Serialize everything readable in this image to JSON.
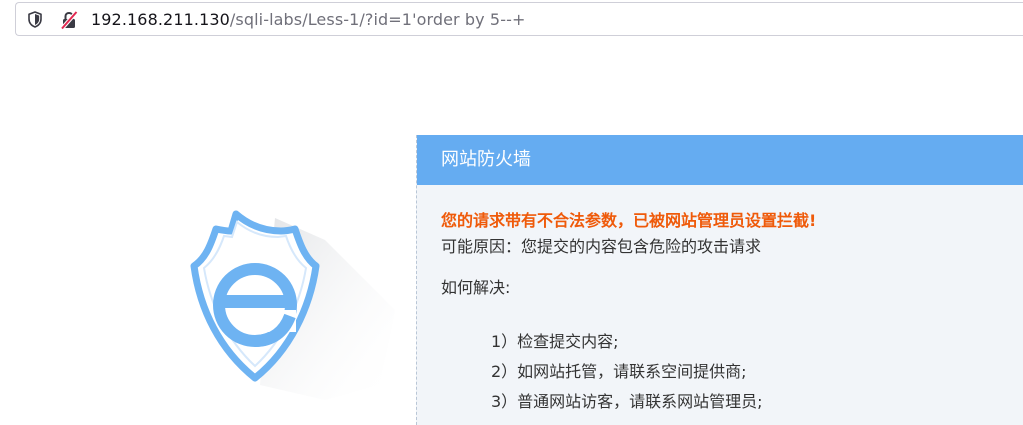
{
  "browser": {
    "url_host": "192.168.211.130",
    "url_path": "/sqli-labs/Less-1/?id=1'order by 5--+",
    "icons": [
      "shield-icon",
      "insecure-lock-icon"
    ],
    "colors": {
      "field_border": "#cfcfd8",
      "insecure_slash": "#e22850"
    }
  },
  "firewall": {
    "header_title": "网站防火墙",
    "warning": "您的请求带有不合法参数，已被网站管理员设置拦截!",
    "reason": "可能原因：您提交的内容包含危险的攻击请求",
    "how_title": "如何解决:",
    "steps": [
      "1）检查提交内容;",
      "2）如网站托管，请联系空间提供商;",
      "3）普通网站访客，请联系网站管理员;"
    ],
    "colors": {
      "header_bg": "#65acf1",
      "warning_text": "#ef5a0a",
      "panel_bg": "#f2f5f9",
      "logo_blue": "#6eb3f2"
    },
    "logo_icon": "shield-e-logo-icon"
  }
}
